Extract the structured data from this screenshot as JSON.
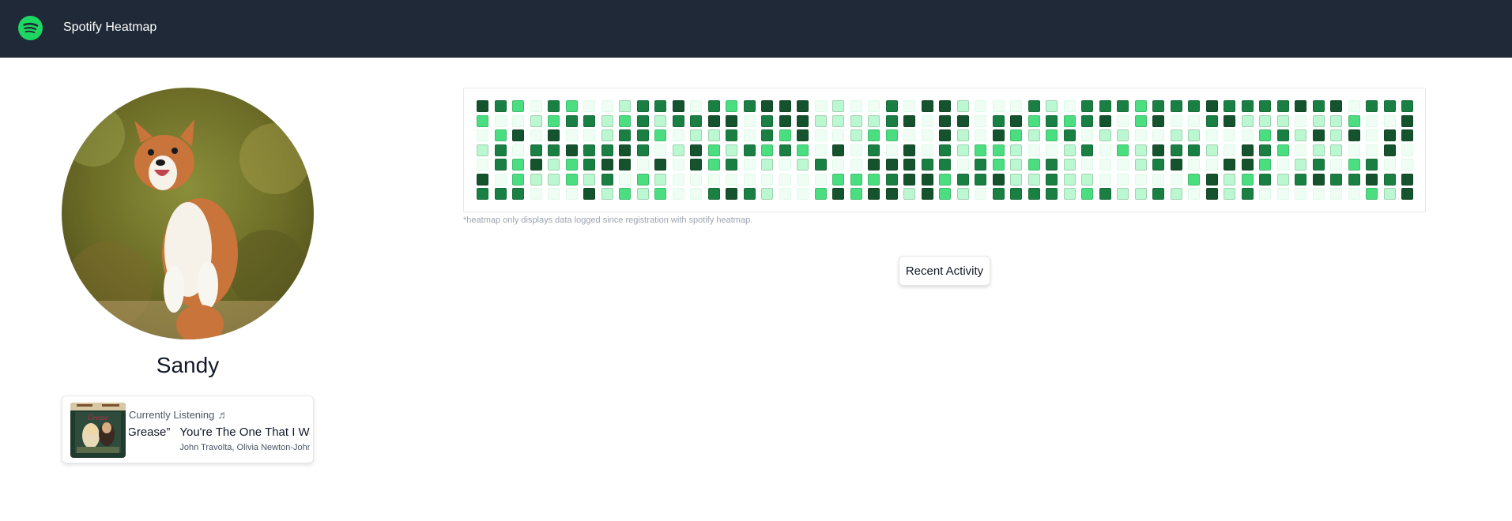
{
  "nav": {
    "brand": "Spotify Heatmap",
    "logo_icon": "spotify-logo-icon",
    "bg_color": "#1f2937",
    "logo_color": "#1ed760"
  },
  "profile": {
    "username": "Sandy",
    "avatar_icon": "corgi-photo"
  },
  "now_playing": {
    "header": "Currently Listening",
    "header_icon": "music-note-icon",
    "tracks": [
      {
        "title": "You're The One That I Want",
        "artist": "John Travolta, Olivia Newton-John"
      },
      {
        "title": "We Go Together - From “Grease”",
        "artist": "John Travolta, Olivia Newton-John"
      }
    ]
  },
  "heatmap": {
    "note": "*heatmap only displays data logged since registration with spotify heatmap.",
    "levels": [
      "#f0fdf4",
      "#bbf7d0",
      "#4ade80",
      "#1a7f43",
      "#14532d"
    ],
    "rows": [
      "4320320013340323444010030441000310333233343333434033340000232431003111433340000404322400433330334434233",
      "2001233123133440344111134044034232340240034111011200430312340413244440103100440322423104144233024233010",
      "0240400133201130324001220041042123011001100023141404443213311022423044131211312331441421121332330302330",
      "1303343343014213232040304031221001302143310432011004022001230010141144332101432331414412133331030412422",
      "0324123440404230101300444330321231000134004420130230001444442303042240221343224010133030012443300033014",
      "4021121302100000000022234423341131100000241231343343413143322221241000341231022413113103213014021114222",
      "3330004121200343100242441421033331231131041300000021413230442240202201100101400441020001402032220121241"
    ]
  },
  "actions": {
    "recent_activity": "Recent Activity"
  }
}
